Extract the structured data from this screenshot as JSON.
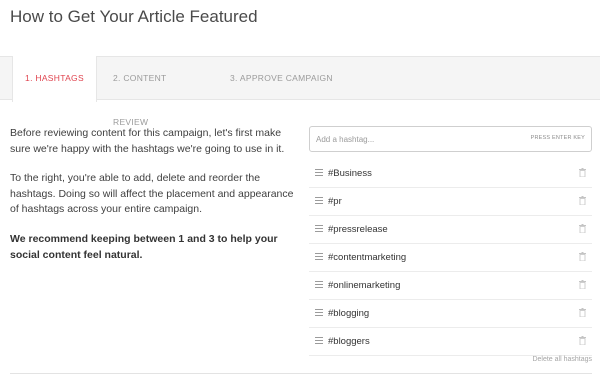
{
  "page": {
    "title": "How to Get Your Article Featured"
  },
  "tabs": [
    {
      "label": "1. HASHTAGS",
      "active": true
    },
    {
      "label": "2. CONTENT REVIEW",
      "active": false
    },
    {
      "label": "3. APPROVE CAMPAIGN",
      "active": false
    }
  ],
  "intro": {
    "p1": "Before reviewing content for this campaign, let's first make sure we're happy with the hashtags we're going to use in it.",
    "p2": "To the right, you're able to add, delete and reorder the hashtags. Doing so will affect the placement and appearance of hashtags across your entire campaign.",
    "p3": "We recommend keeping between 1 and 3 to help your social content feel natural."
  },
  "hashtag_input": {
    "placeholder": "Add a hashtag...",
    "value": "",
    "hint": "PRESS ENTER KEY"
  },
  "hashtags": [
    "#Business",
    "#pr",
    "#pressrelease",
    "#contentmarketing",
    "#onlinemarketing",
    "#blogging",
    "#bloggers"
  ],
  "actions": {
    "delete_all": "Delete all hashtags"
  },
  "colors": {
    "accent": "#e0444f",
    "tab_bar": "#f5f5f5",
    "muted": "#9b9b9b"
  },
  "icons": {
    "drag": "drag-handle-icon",
    "delete": "trash-icon"
  }
}
